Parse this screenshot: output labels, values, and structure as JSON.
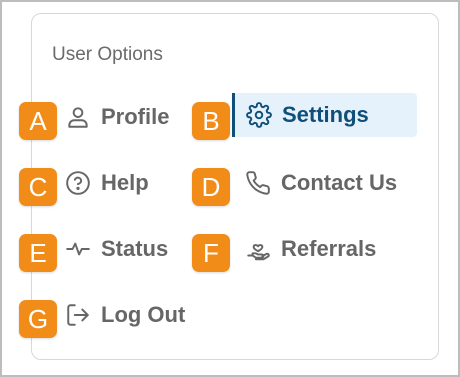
{
  "menu": {
    "heading": "User Options",
    "items": [
      {
        "label": "Profile",
        "icon": "user-icon",
        "badge": "A"
      },
      {
        "label": "Settings",
        "icon": "gear-icon",
        "badge": "B"
      },
      {
        "label": "Help",
        "icon": "question-circle-icon",
        "badge": "C"
      },
      {
        "label": "Contact Us",
        "icon": "phone-icon",
        "badge": "D"
      },
      {
        "label": "Status",
        "icon": "activity-icon",
        "badge": "E"
      },
      {
        "label": "Referrals",
        "icon": "hand-heart-icon",
        "badge": "F"
      },
      {
        "label": "Log Out",
        "icon": "logout-icon",
        "badge": "G"
      }
    ],
    "active_item": "Settings"
  },
  "colors": {
    "accent": "#0f4f7a",
    "active_background": "#e6f2fb",
    "badge": "#f28c18",
    "text": "#666666"
  }
}
